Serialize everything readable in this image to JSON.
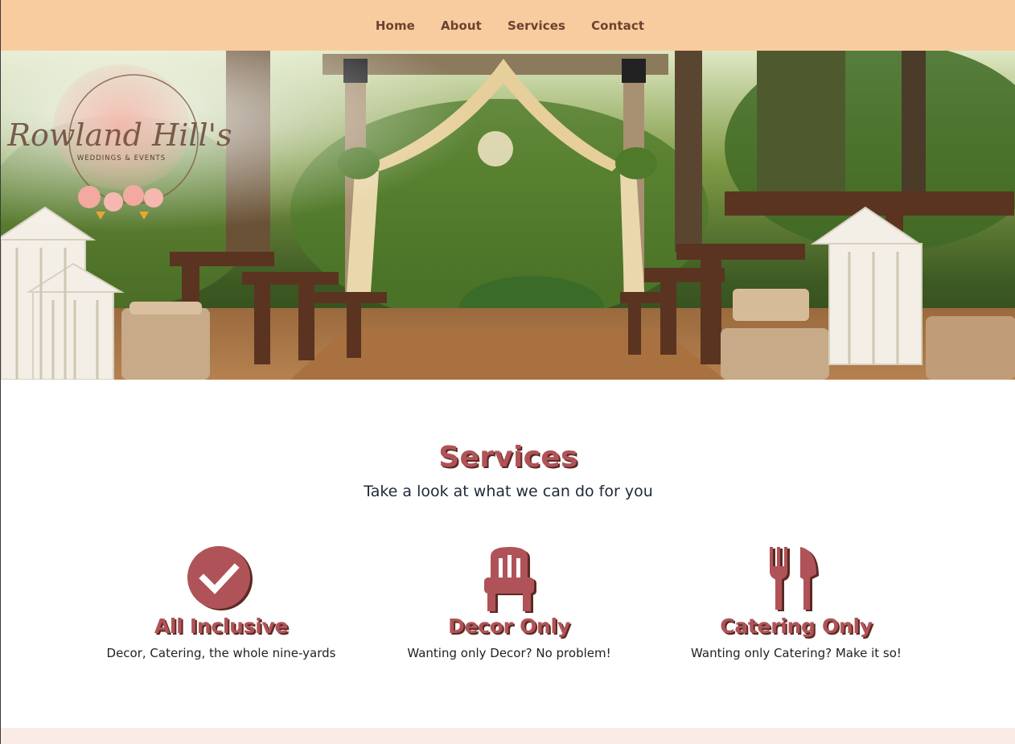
{
  "nav": {
    "items": [
      {
        "label": "Home"
      },
      {
        "label": "About"
      },
      {
        "label": "Services"
      },
      {
        "label": "Contact"
      }
    ]
  },
  "hero": {
    "logo": {
      "script_text": "Rowland Hill's",
      "tagline": "WEDDINGS & EVENTS"
    }
  },
  "services": {
    "title": "Services",
    "subtitle": "Take a look at what we can do for you",
    "cards": [
      {
        "icon": "check-circle-icon",
        "heading": "All Inclusive",
        "description": "Decor, Catering, the whole nine-yards"
      },
      {
        "icon": "chair-icon",
        "heading": "Decor Only",
        "description": "Wanting only Decor? No problem!"
      },
      {
        "icon": "fork-knife-icon",
        "heading": "Catering Only",
        "description": "Wanting only Catering? Make it so!"
      }
    ]
  },
  "colors": {
    "nav_bg": "#f9cc9f",
    "nav_text": "#6b4330",
    "accent": "#b05358",
    "accent_shadow": "#5b2a22",
    "footer_strip": "#faebe6"
  }
}
